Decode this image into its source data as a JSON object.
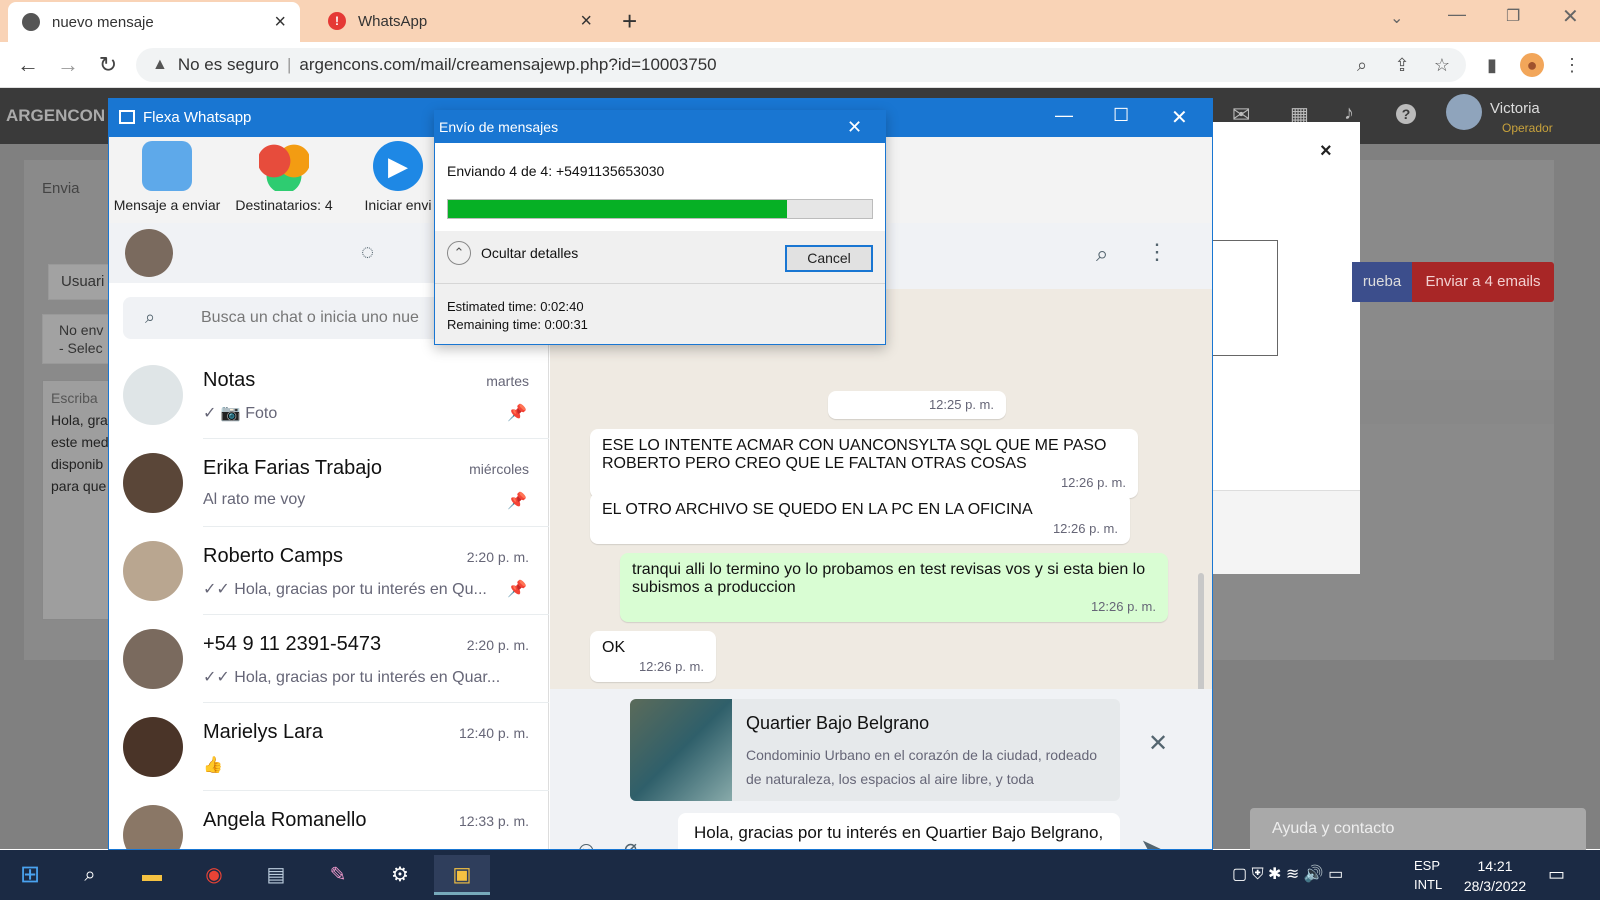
{
  "browser": {
    "tabs": [
      {
        "title": "nuevo mensaje",
        "active": true
      },
      {
        "title": "WhatsApp",
        "active": false
      }
    ],
    "address": {
      "security": "No es seguro",
      "url": "argencons.com/mail/creamensajewp.php?id=10003750"
    }
  },
  "web": {
    "brand": "ARGENCON",
    "user_name": "Victoria",
    "user_role": "Operador",
    "left_labels": [
      "Envia",
      "Usuari",
      "No env",
      "- Selec",
      "Escriba",
      "Hola, gra",
      "este med",
      "disponib",
      "para que"
    ],
    "btn_prueba": "rueba",
    "btn_emails": "Enviar a 4 emails",
    "ayuda": "Ayuda y contacto"
  },
  "flexa": {
    "title": "Flexa Whatsapp",
    "ribbon": [
      {
        "label": "Mensaje a enviar"
      },
      {
        "label": "Destinatarios: 4"
      },
      {
        "label": "Iniciar envi"
      }
    ],
    "search_placeholder": "Busca un chat o inicia uno nue",
    "chats": [
      {
        "name": "Notas",
        "time": "martes",
        "preview": "✓ 📷 Foto",
        "pinned": true
      },
      {
        "name": "Erika Farias Trabajo",
        "time": "miércoles",
        "preview": "Al rato me voy",
        "pinned": true
      },
      {
        "name": "Roberto Camps",
        "time": "2:20 p. m.",
        "preview": "✓✓ Hola, gracias por tu interés en Qu...",
        "pinned": true
      },
      {
        "name": "+54 9 11 2391-5473",
        "time": "2:20 p. m.",
        "preview": "✓✓ Hola, gracias por tu interés en Quar...",
        "pinned": false
      },
      {
        "name": "Marielys Lara",
        "time": "12:40 p. m.",
        "preview": "👍",
        "pinned": false
      },
      {
        "name": "Angela Romanello",
        "time": "12:33 p. m.",
        "preview": "",
        "pinned": false
      }
    ],
    "messages": [
      {
        "text": "",
        "time": "12:25 p. m.",
        "out": false
      },
      {
        "text": "ESE LO INTENTE ACMAR CON UANCONSYLTA SQL QUE ME PASO ROBERTO PERO CREO QUE LE FALTAN OTRAS COSAS",
        "time": "12:26 p. m.",
        "out": false
      },
      {
        "text": "EL OTRO ARCHIVO SE QUEDO EN LA PC EN LA OFICINA",
        "time": "12:26 p. m.",
        "out": false
      },
      {
        "text": "tranqui alli lo termino yo lo probamos en test revisas vos y si esta bien lo subismos a produccion",
        "time": "12:26 p. m.",
        "out": true
      },
      {
        "text": "OK",
        "time": "12:26 p. m.",
        "out": false
      }
    ],
    "link_preview": {
      "title": "Quartier Bajo Belgrano",
      "desc": "Condominio Urbano en el corazón de la ciudad, rodeado de naturaleza, los espacios al aire libre, y toda"
    },
    "compose_text": "Hola, gracias por tu interés en Quartier Bajo Belgrano, Condominio Urbano. Estamos a tu disposición por este medio para cualquier consulta, o esperamos tu llamado al +54-11-43118008. - Para ver unidades disponibles y sus"
  },
  "dialog": {
    "title": "Envío de mensajes",
    "status": "Enviando 4 de 4: +5491135653030",
    "progress": 0.8,
    "details_toggle": "Ocultar detalles",
    "cancel": "Cancel",
    "estimated": "Estimated time: 0:02:40",
    "remaining": "Remaining time: 0:00:31"
  },
  "taskbar": {
    "lang1": "ESP",
    "lang2": "INTL",
    "time": "14:21",
    "date": "28/3/2022"
  }
}
